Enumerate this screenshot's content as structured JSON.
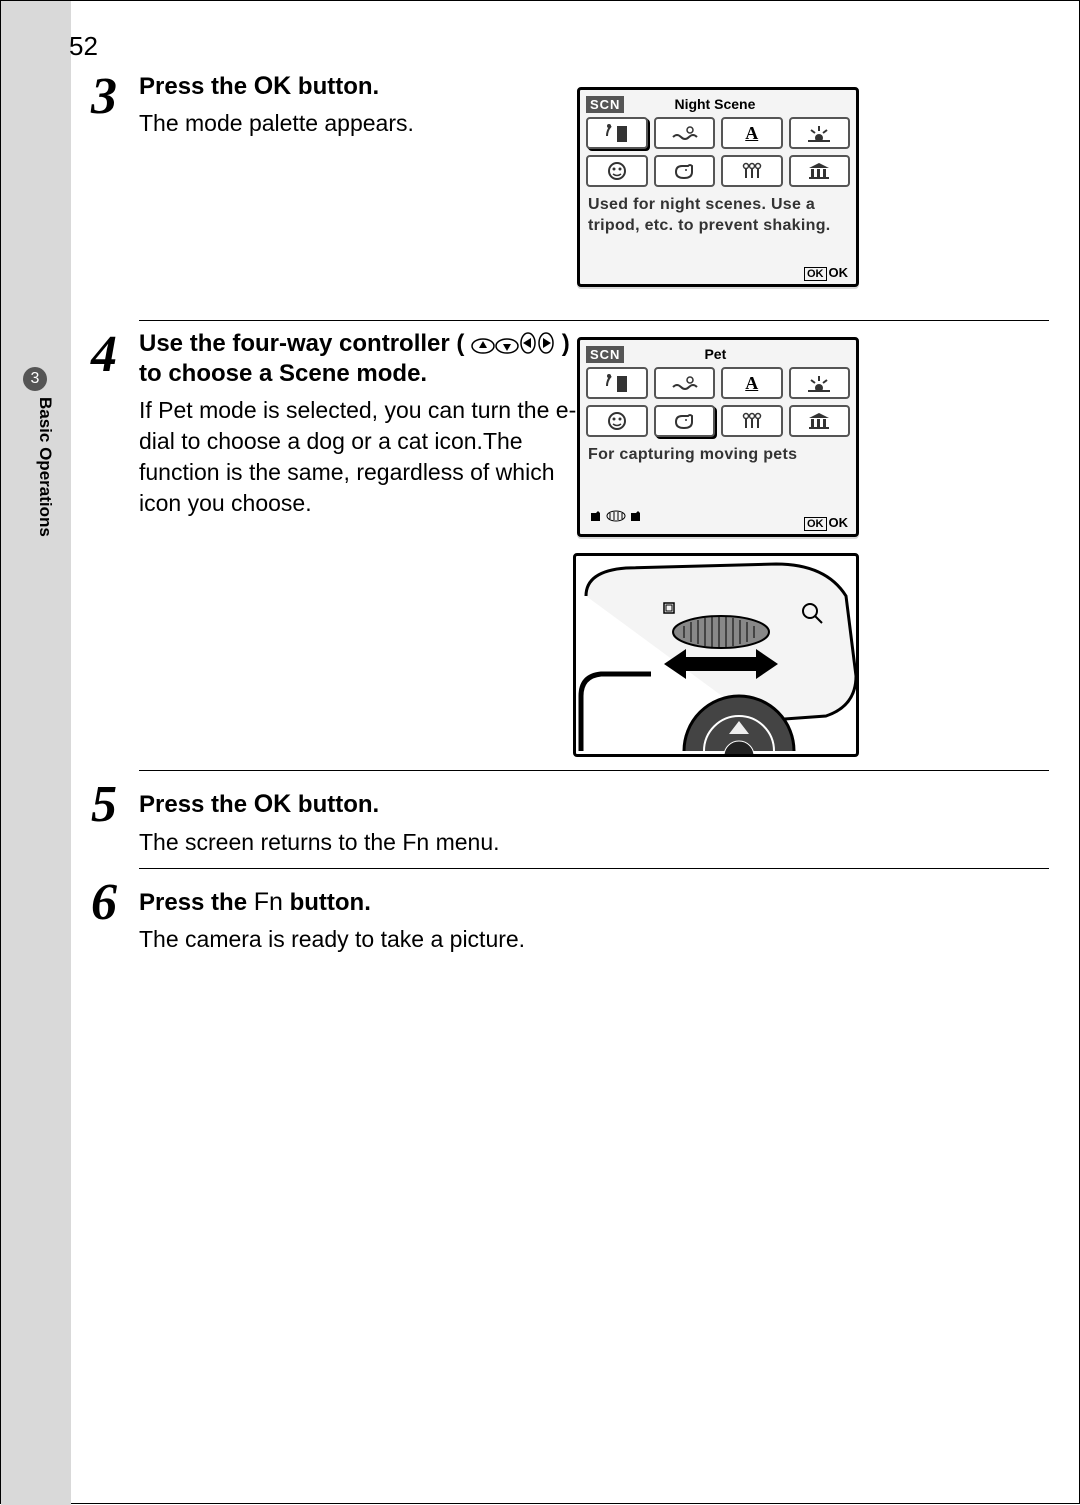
{
  "page_number": "52",
  "section": {
    "number": "3",
    "title": "Basic Operations"
  },
  "steps": [
    {
      "num": "3",
      "head_pre": "Press the ",
      "head_btn": "OK",
      "head_post": " button.",
      "body": "The mode palette appears."
    },
    {
      "num": "4",
      "head_pre": "Use the four-way controller (",
      "head_post": ") to choose a Scene mode.",
      "body": "If Pet mode is selected, you can turn the e-dial to choose a dog or a cat icon.The function is the same, regardless of which icon you choose."
    },
    {
      "num": "5",
      "head_pre": "Press the ",
      "head_btn": "OK",
      "head_post": " button.",
      "body": "The screen returns to the Fn menu."
    },
    {
      "num": "6",
      "head_pre": "Press the ",
      "head_btn": "Fn",
      "head_post": " button.",
      "body": "The camera is ready to take a picture."
    }
  ],
  "screen_night": {
    "scn": "SCN",
    "title": "Night Scene",
    "desc": "Used for night scenes. Use a tripod, etc. to prevent shaking.",
    "ok_label": "OK",
    "ok_inner": "OK"
  },
  "screen_pet": {
    "scn": "SCN",
    "title": "Pet",
    "desc": "For capturing moving pets",
    "ok_label": "OK",
    "ok_inner": "OK"
  },
  "icons": {
    "modes": [
      "night-building",
      "swim",
      "text-a",
      "sunset",
      "kid",
      "pet-dog",
      "candle",
      "museum"
    ]
  }
}
